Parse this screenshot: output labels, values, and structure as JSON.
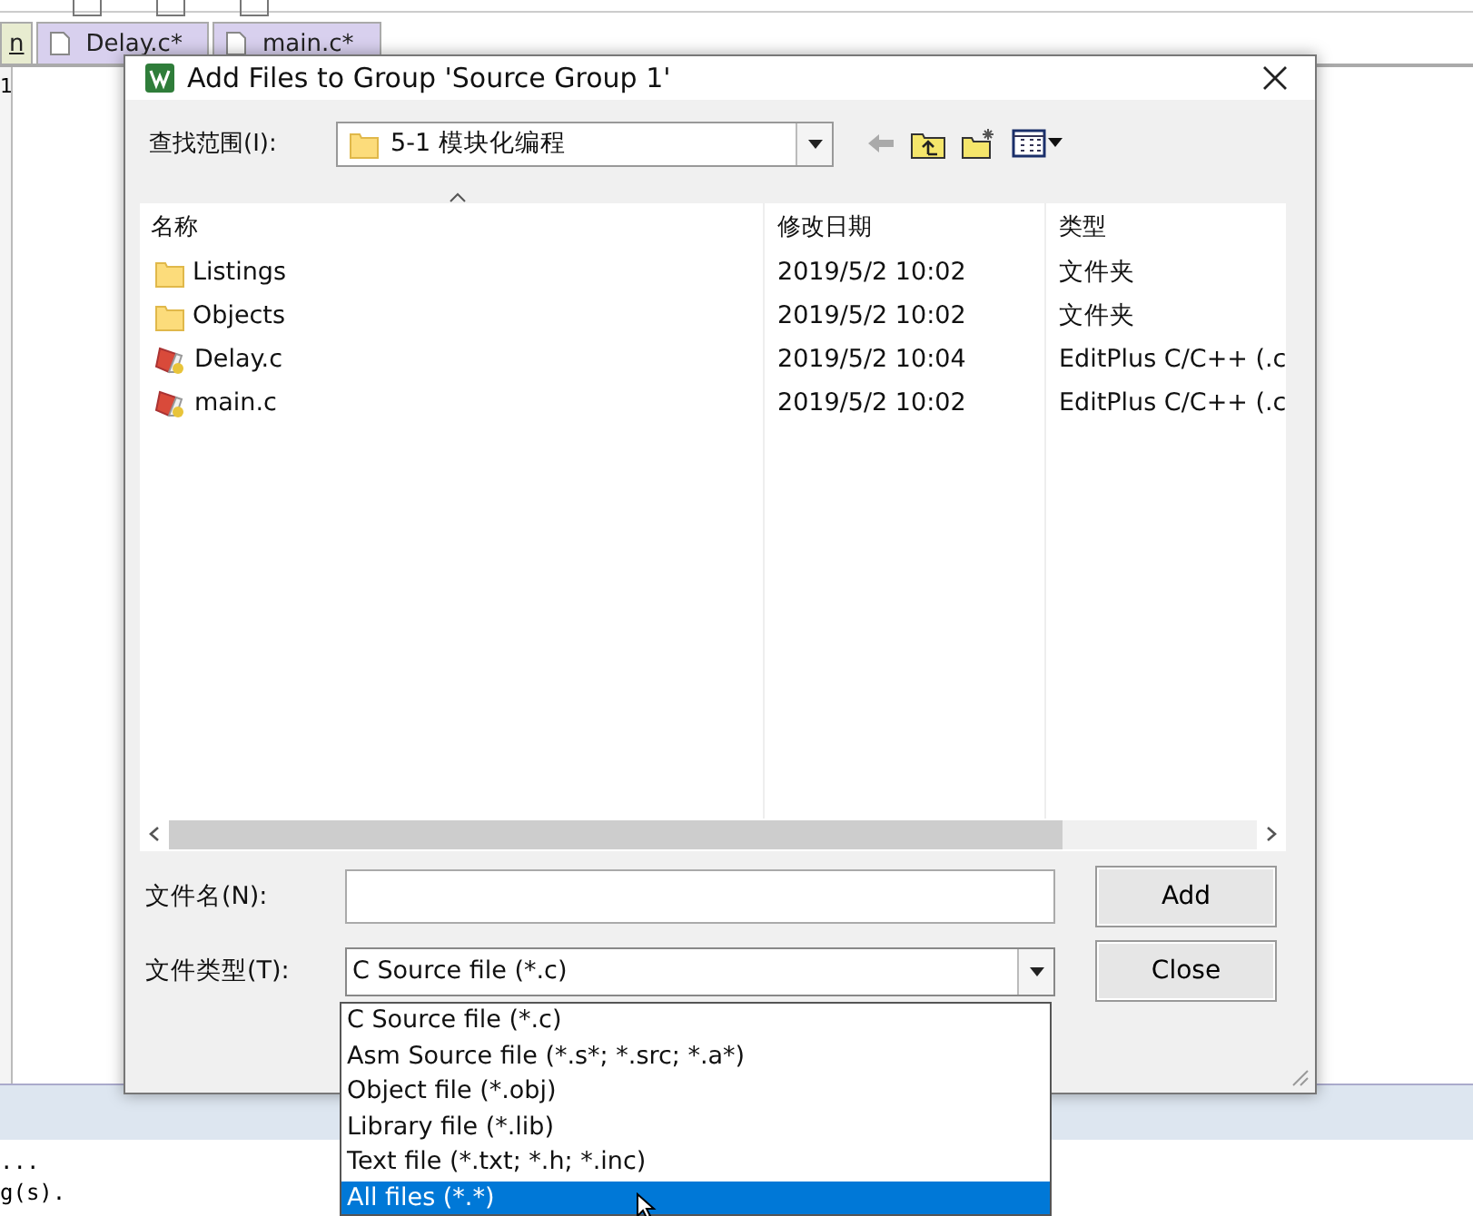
{
  "ide": {
    "tabs": [
      {
        "label": "n",
        "selected": true
      },
      {
        "label": "Delay.c*",
        "selected": false
      },
      {
        "label": "main.c*",
        "selected": false
      }
    ],
    "line_number": "1",
    "output_lines": [
      "...",
      "g(s)."
    ]
  },
  "dialog": {
    "title": "Add Files to Group 'Source Group 1'",
    "look_in_label": "查找范围(I):",
    "look_in_value": "5-1 模块化编程",
    "columns": [
      "名称",
      "修改日期",
      "类型"
    ],
    "rows": [
      {
        "kind": "folder",
        "name": "Listings",
        "date": "2019/5/2 10:02",
        "type": "文件夹"
      },
      {
        "kind": "folder",
        "name": "Objects",
        "date": "2019/5/2 10:02",
        "type": "文件夹"
      },
      {
        "kind": "source",
        "name": "Delay.c",
        "date": "2019/5/2 10:04",
        "type": "EditPlus C/C++ (.c"
      },
      {
        "kind": "source",
        "name": "main.c",
        "date": "2019/5/2 10:02",
        "type": "EditPlus C/C++ (.c"
      }
    ],
    "file_name_label": "文件名(N):",
    "file_type_label": "文件类型(T):",
    "file_type_value": "C Source file (*.c)",
    "file_type_options": [
      {
        "label": "C Source file (*.c)",
        "selected": false
      },
      {
        "label": "Asm Source file (*.s*; *.src; *.a*)",
        "selected": false
      },
      {
        "label": "Object file (*.obj)",
        "selected": false
      },
      {
        "label": "Library file (*.lib)",
        "selected": false
      },
      {
        "label": "Text file (*.txt; *.h; *.inc)",
        "selected": false
      },
      {
        "label": "All files (*.*)",
        "selected": true
      }
    ],
    "buttons": [
      "Add",
      "Close"
    ]
  }
}
